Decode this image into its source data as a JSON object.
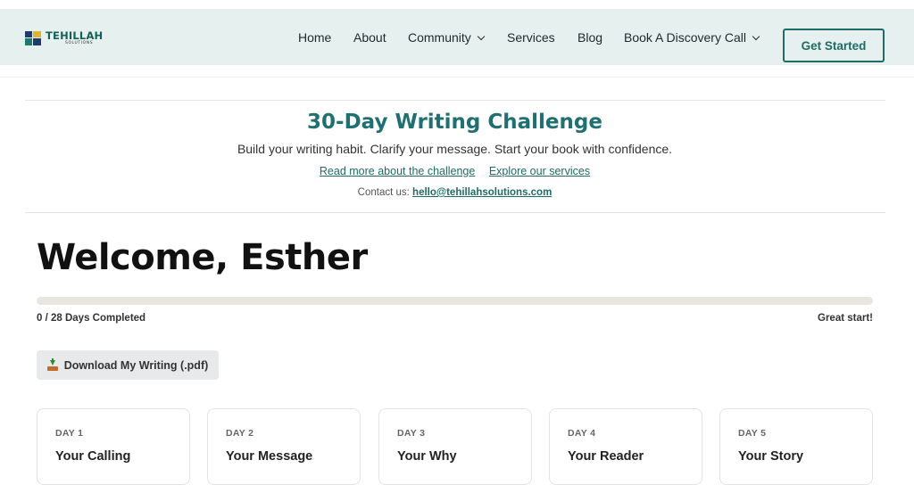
{
  "header": {
    "logo": {
      "main": "TEHILLAH",
      "sub": "SOLUTIONS"
    },
    "nav": [
      {
        "label": "Home",
        "dropdown": false
      },
      {
        "label": "About",
        "dropdown": false
      },
      {
        "label": "Community",
        "dropdown": true
      },
      {
        "label": "Services",
        "dropdown": false
      },
      {
        "label": "Blog",
        "dropdown": false
      },
      {
        "label": "Book A Discovery Call",
        "dropdown": true
      }
    ],
    "cta_label": "Get Started"
  },
  "banner": {
    "title": "30-Day Writing Challenge",
    "subtitle": "Build your writing habit. Clarify your message. Start your book with confidence.",
    "link_read_more": "Read more about the challenge",
    "link_services": "Explore our services",
    "contact_prefix": "Contact us:",
    "contact_email": "hello@tehillahsolutions.com"
  },
  "main": {
    "welcome": "Welcome, Esther",
    "progress": {
      "completed": 0,
      "total": 28,
      "label": "0 / 28 Days Completed",
      "message": "Great start!"
    },
    "download_label": "Download My Writing (.pdf)",
    "days": [
      {
        "day": "DAY 1",
        "title": "Your Calling"
      },
      {
        "day": "DAY 2",
        "title": "Your Message"
      },
      {
        "day": "DAY 3",
        "title": "Your Why"
      },
      {
        "day": "DAY 4",
        "title": "Your Reader"
      },
      {
        "day": "DAY 5",
        "title": "Your Story"
      }
    ]
  },
  "colors": {
    "accent": "#1f7071",
    "header_bg": "#e5f0ef",
    "progress_track": "#e9e5df"
  }
}
